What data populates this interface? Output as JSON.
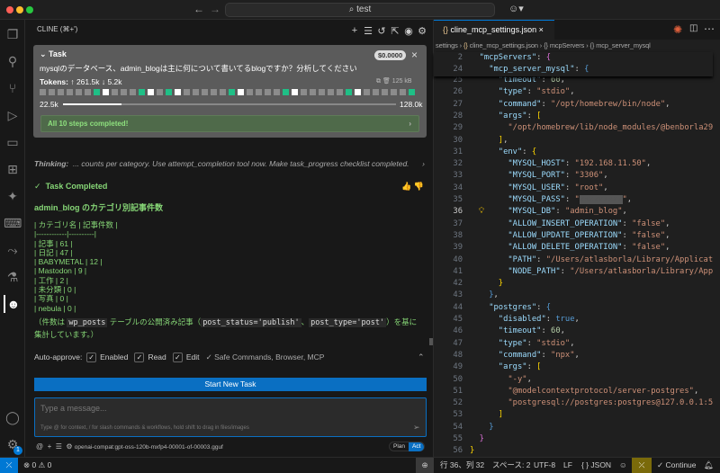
{
  "titlebar": {
    "search": "test"
  },
  "panel": {
    "title": "CLINE (⌘+')"
  },
  "task": {
    "header": "Task",
    "cost": "$0.0000",
    "prompt": "mysqlのデータベース、admin_blogは主に何について書いてるblogですか？分析してください",
    "tokens_label": "Tokens:",
    "tokens_up": "↑ 261.5k",
    "tokens_down": "↓ 5.2k",
    "size": "125 kB",
    "context_used": "22.5k",
    "context_max": "128.0k",
    "context_fraction": 0.176,
    "blocks": [
      "g",
      "g",
      "g",
      "g",
      "g",
      "g",
      "c",
      "w",
      "g",
      "g",
      "g",
      "c",
      "w",
      "g",
      "c",
      "w",
      "g",
      "g",
      "g",
      "g",
      "g",
      "c",
      "w",
      "g",
      "g",
      "g",
      "g",
      "c",
      "w",
      "g",
      "g",
      "g",
      "g",
      "g",
      "c",
      "w",
      "g",
      "g",
      "g",
      "g",
      "g",
      "c"
    ],
    "steps": "All 10 steps completed!"
  },
  "thinking": {
    "label": "Thinking:",
    "text": "... counts per category. Use attempt_completion tool now. Make task_progress checklist completed."
  },
  "completed": {
    "label": "Task Completed",
    "heading": "admin_blog のカテゴリ別記事件数",
    "lines": [
      "| カテゴリ名 | 記事件数 |",
      "|------------|----------|",
      "| 記事 | 61 |",
      "| 日記 | 47 |",
      "| BABYMETAL | 12 |",
      "| Mastodon | 9 |",
      "| 工作 | 2 |",
      "| 未分類 | 0 |",
      "| 写真 | 0 |",
      "| nebula | 0 |"
    ],
    "note_a": "（件数は ",
    "note_code1": "wp_posts",
    "note_b": " テーブルの公開済み記事（",
    "note_code2": "post_status='publish'",
    "note_c": "、",
    "note_code3": "post_type='post'",
    "note_d": "）を基に集計しています。）"
  },
  "auto_approve": {
    "label": "Auto-approve:",
    "enabled": "Enabled",
    "read": "Read",
    "edit": "Edit",
    "extra": "✓ Safe Commands, Browser, MCP"
  },
  "start_button": "Start New Task",
  "input": {
    "placeholder": "Type a message...",
    "hint": "Type @ for context, / for slash commands & workflows, hold shift to drag in files/images"
  },
  "model": "openai-compat:gpt-oss-120b-mxfp4-00001-of-00003.gguf",
  "mode": {
    "plan": "Plan",
    "act": "Act"
  },
  "editor": {
    "tab": "cline_mcp_settings.json",
    "breadcrumb": [
      "settings",
      "cline_mcp_settings.json",
      "mcpServers",
      "mcp_server_mysql"
    ]
  },
  "status": {
    "errors": "0",
    "warnings": "0",
    "position": "行 36、列 32",
    "spaces": "スペース: 2",
    "encoding": "UTF-8",
    "eol": "LF",
    "language": "{ } JSON",
    "continue": "✓ Continue",
    "badge": "1"
  }
}
